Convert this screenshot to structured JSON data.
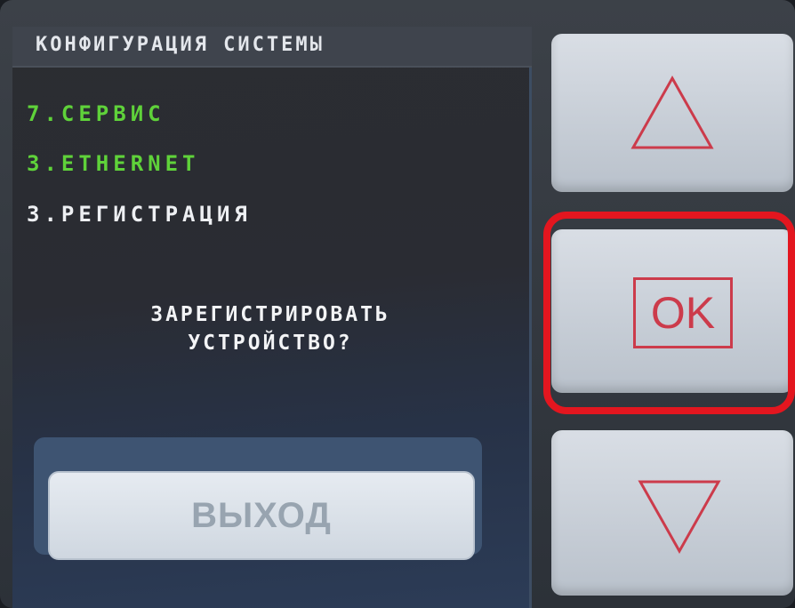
{
  "screen": {
    "title": "КОНФИГУРАЦИЯ СИСТЕМЫ",
    "menu_items": [
      {
        "label": "7.СЕРВИС",
        "color": "#5fd23a"
      },
      {
        "label": "3.ETHERNET",
        "color": "#5fd23a"
      },
      {
        "label": "3.РЕГИСТРАЦИЯ",
        "color": "#eef0f3"
      }
    ],
    "question_line1": "ЗАРЕГИСТРИРОВАТЬ",
    "question_line2": "УСТРОЙСТВО?",
    "exit_label": "ВЫХОД"
  },
  "buttons": {
    "up_icon": "triangle-up-icon",
    "ok_label": "OK",
    "down_icon": "triangle-down-icon"
  },
  "colors": {
    "highlight": "#e3161f",
    "icon": "#cc3b4b",
    "menu_green": "#5fd23a"
  }
}
